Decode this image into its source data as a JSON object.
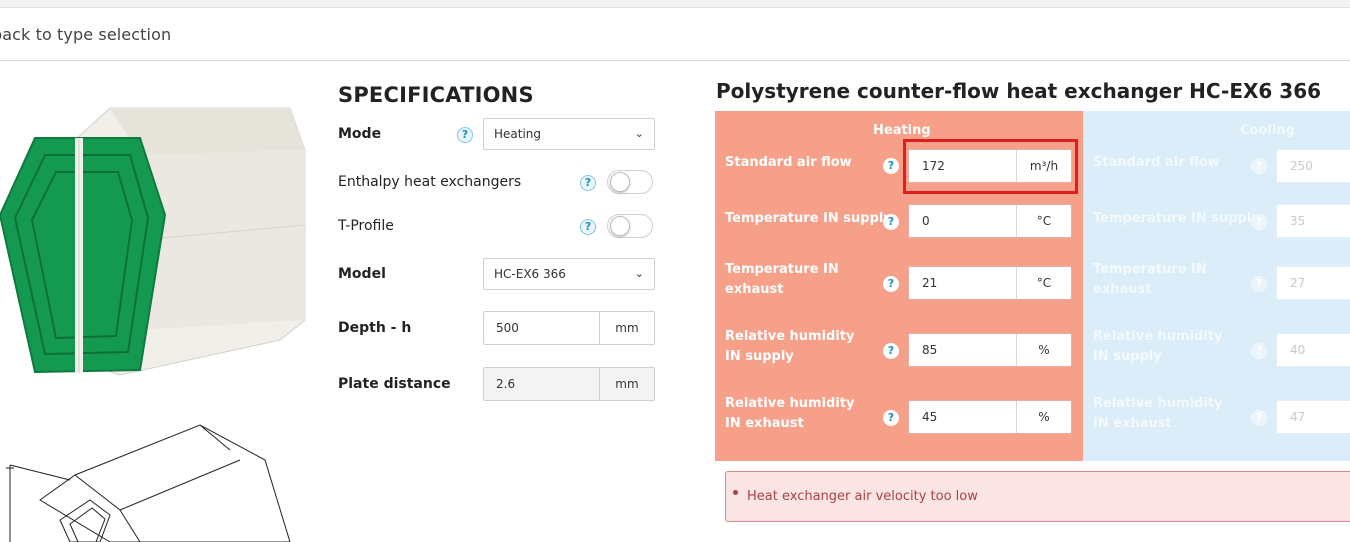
{
  "nav": {
    "back_label": "back to type selection"
  },
  "specifications": {
    "title": "SPECIFICATIONS",
    "mode": {
      "label": "Mode",
      "value": "Heating"
    },
    "enthalpy": {
      "label": "Enthalpy heat exchangers",
      "enabled": false
    },
    "t_profile": {
      "label": "T-Profile",
      "enabled": false
    },
    "model": {
      "label": "Model",
      "value": "HC-EX6 366"
    },
    "depth": {
      "label": "Depth - h",
      "value": "500",
      "unit": "mm"
    },
    "plate_distance": {
      "label": "Plate distance",
      "value": "2.6",
      "unit": "mm"
    },
    "help_glyph": "?"
  },
  "product": {
    "title": "Polystyrene counter-flow heat exchanger HC-EX6 366"
  },
  "heating": {
    "header": "Heating",
    "rows": [
      {
        "label": "Standard air flow",
        "value": "172",
        "unit": "m³/h"
      },
      {
        "label": "Temperature IN supply",
        "value": "0",
        "unit": "°C"
      },
      {
        "label": "Temperature IN exhaust",
        "value": "21",
        "unit": "°C"
      },
      {
        "label": "Relative humidity IN supply",
        "value": "85",
        "unit": "%"
      },
      {
        "label": "Relative humidity IN exhaust",
        "value": "45",
        "unit": "%"
      }
    ]
  },
  "cooling": {
    "header": "Cooling",
    "rows": [
      {
        "label": "Standard air flow",
        "value": "250"
      },
      {
        "label": "Temperature IN supply",
        "value": "35"
      },
      {
        "label": "Temperature IN exhaust",
        "value": "27"
      },
      {
        "label": "Relative humidity IN supply",
        "value": "40"
      },
      {
        "label": "Relative humidity IN exhaust",
        "value": "47"
      }
    ]
  },
  "alert": {
    "message": "Heat exchanger air velocity too low"
  },
  "colors": {
    "heating_panel": "#f6a08a",
    "cooling_panel": "#daedf8",
    "highlight": "#e21d1d",
    "brand_green": "#149a50",
    "alert_text": "#a94442"
  }
}
